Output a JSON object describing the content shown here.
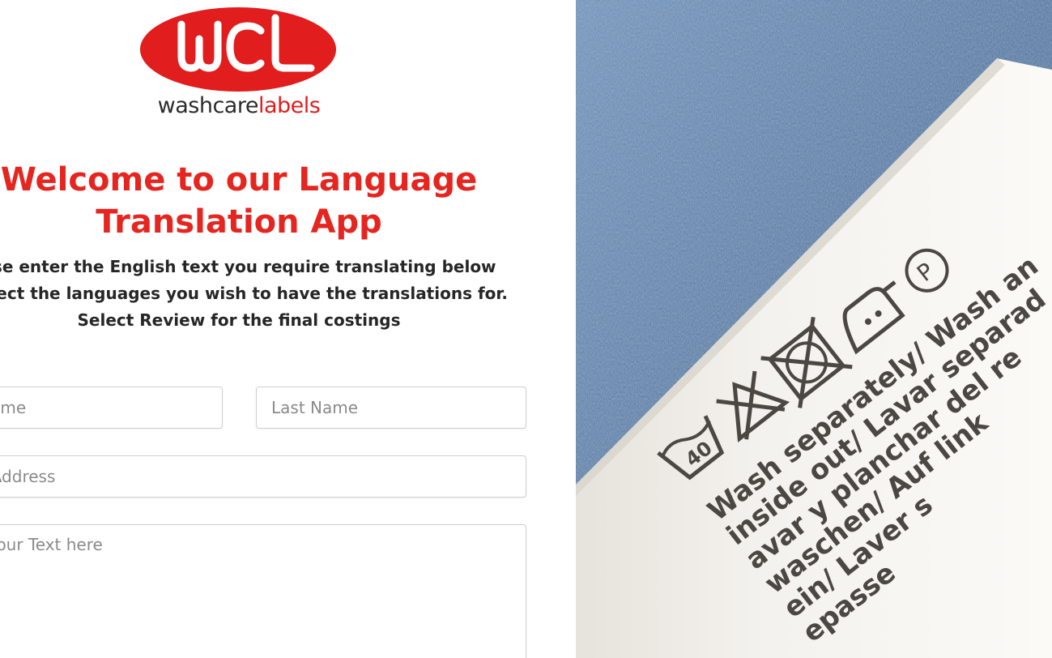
{
  "brand": {
    "logo_letters": "WCL",
    "logo_text_dark": "washcare",
    "logo_text_red": "labels",
    "brand_red": "#e11d1d"
  },
  "hero": {
    "title_line1": "Welcome to our Language",
    "title_line2": "Translation App",
    "intro_line1": "ase enter the English text you require translating below",
    "intro_line2": "select the languages you wish to have the translations for.",
    "intro_line3": "Select Review for the final costings"
  },
  "form": {
    "first_name_placeholder": "t Name",
    "last_name_placeholder": "Last Name",
    "email_placeholder": "ail Address",
    "message_placeholder": "er Your Text here"
  },
  "photo": {
    "label_lines": [
      "Wash separately/ Wash an",
      "inside out/ Lavar separad",
      "avar y planchar del re",
      "waschen/ Auf link",
      "ein/ Laver s",
      "epasse"
    ],
    "wash_temp": "40",
    "registered_mark": "P"
  },
  "colors": {
    "title_red": "#e52520",
    "denim": "#5b7fa8",
    "label": "#f1efea"
  }
}
